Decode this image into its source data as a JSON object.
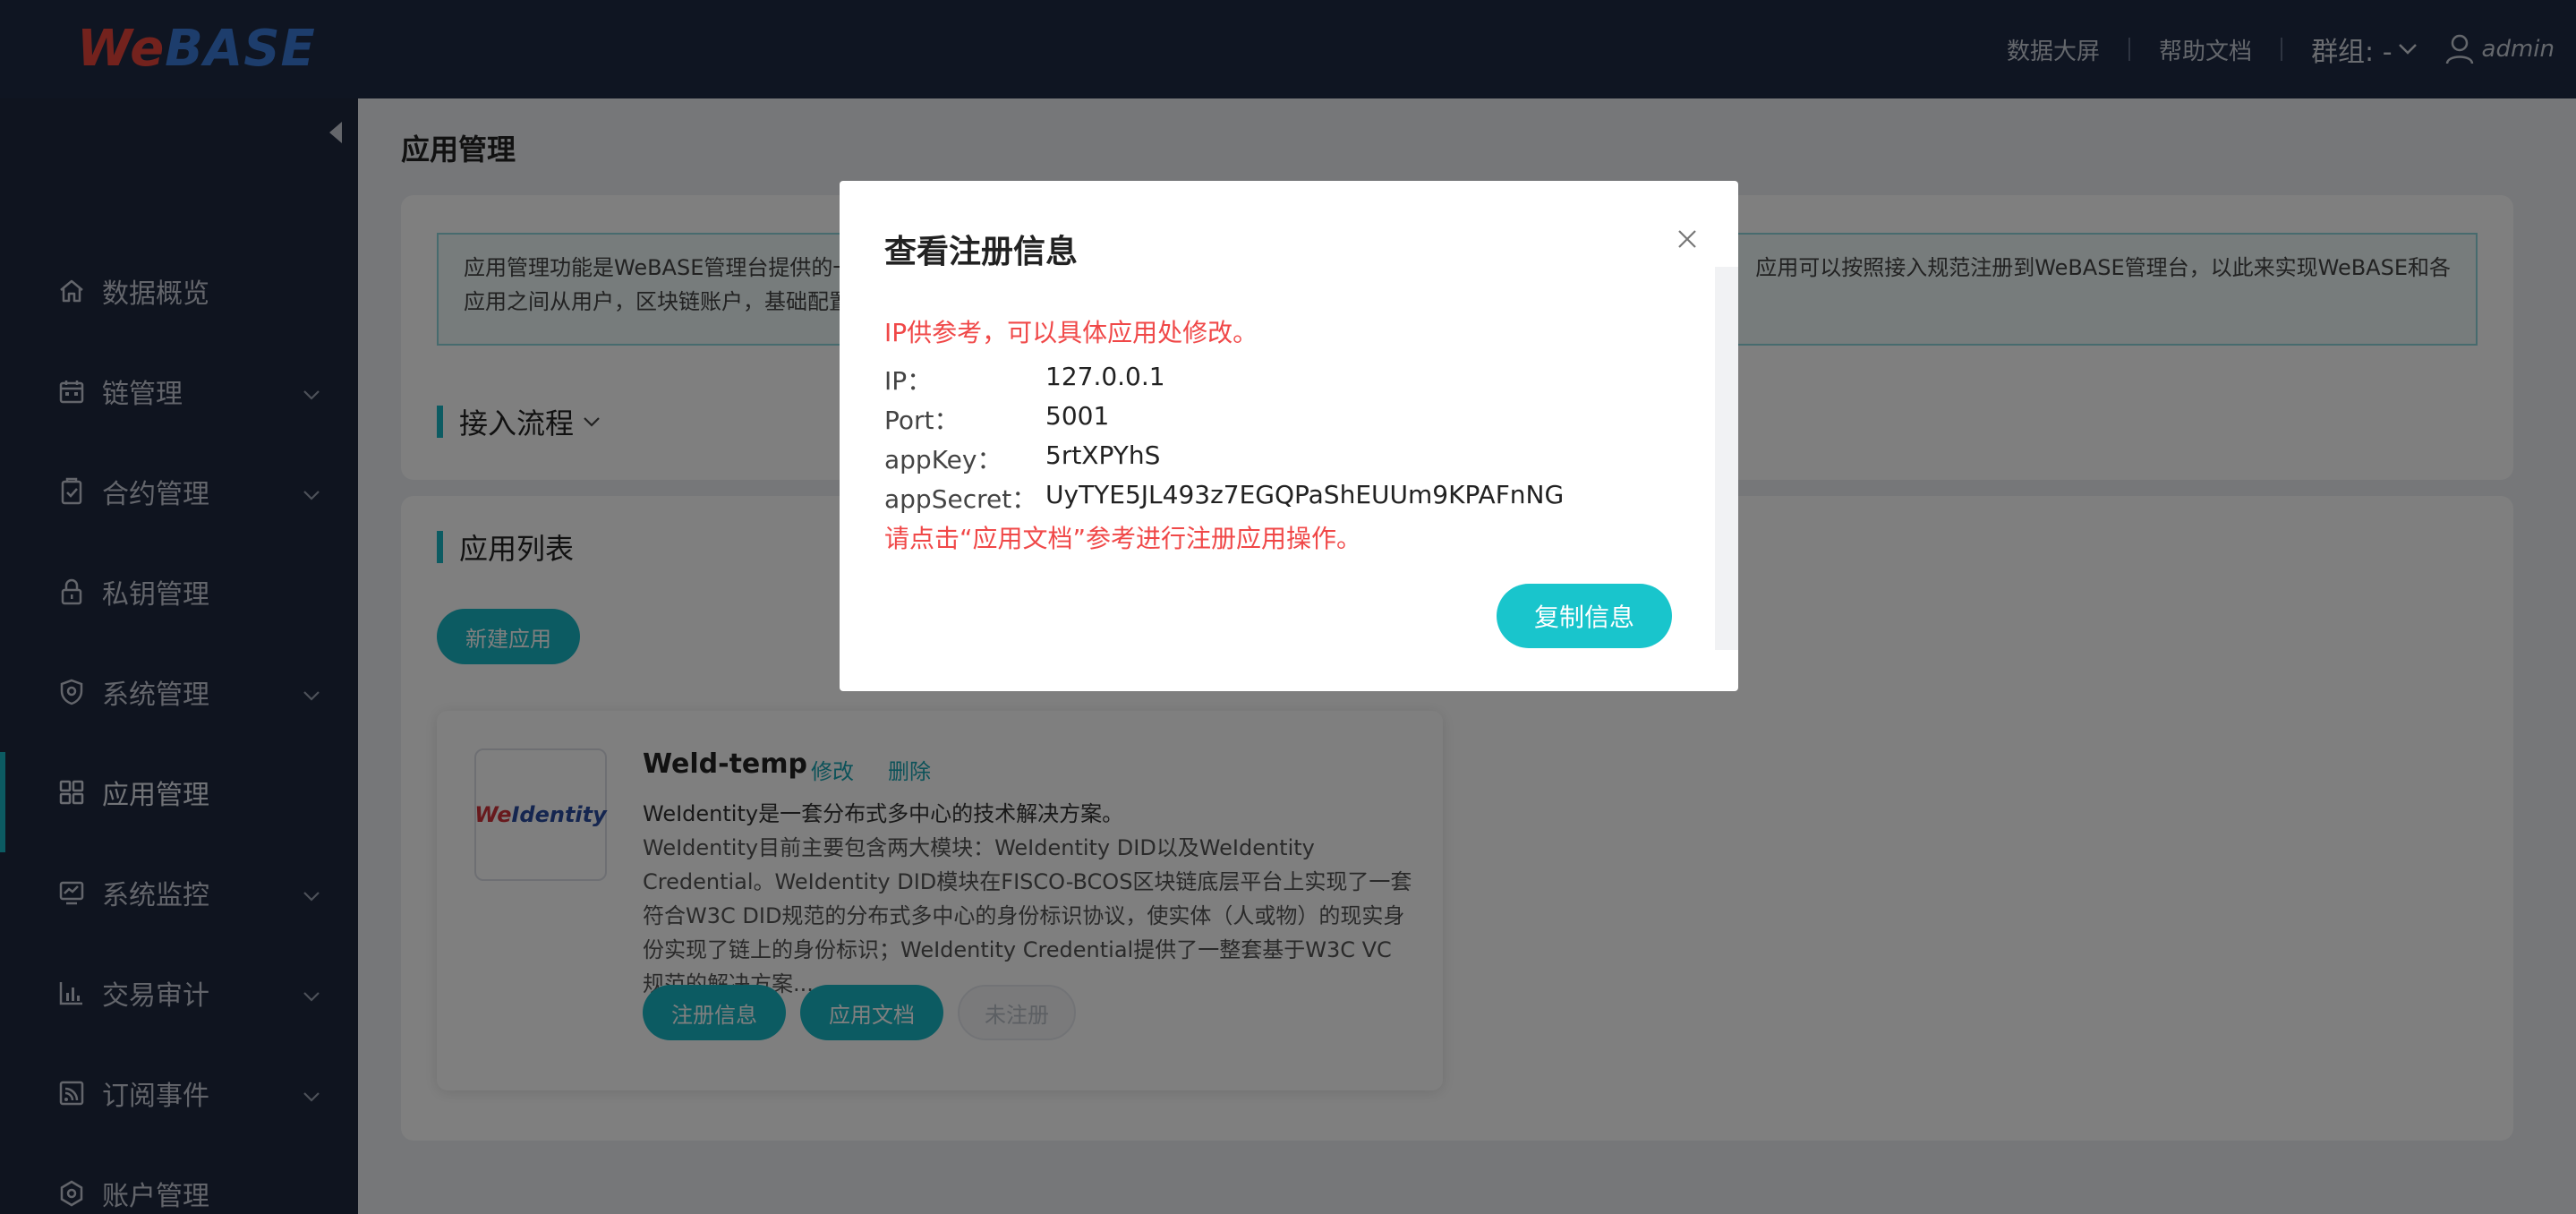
{
  "header": {
    "logo_we": "We",
    "logo_base": "BASE",
    "nav": [
      "数据大屏",
      "帮助文档"
    ],
    "group_label": "群组: -",
    "user": "admin"
  },
  "sidebar": {
    "items": [
      {
        "label": "数据概览",
        "icon": "home-icon",
        "has_children": false
      },
      {
        "label": "链管理",
        "icon": "calendar-icon",
        "has_children": true
      },
      {
        "label": "合约管理",
        "icon": "clipboard-icon",
        "has_children": true
      },
      {
        "label": "私钥管理",
        "icon": "lock-icon",
        "has_children": false
      },
      {
        "label": "系统管理",
        "icon": "shield-icon",
        "has_children": true
      },
      {
        "label": "应用管理",
        "icon": "grid-icon",
        "has_children": false,
        "active": true
      },
      {
        "label": "系统监控",
        "icon": "monitor-icon",
        "has_children": true
      },
      {
        "label": "交易审计",
        "icon": "bar-chart-icon",
        "has_children": true
      },
      {
        "label": "订阅事件",
        "icon": "rss-icon",
        "has_children": true
      },
      {
        "label": "账户管理",
        "icon": "hexagon-icon",
        "has_children": false
      }
    ]
  },
  "main": {
    "page_title": "应用管理",
    "notice_line1_left": "应用管理功能是WeBASE管理台提供的一",
    "notice_line1_right": "应用可以按照接入规范注册到WeBASE管理台，以此来实现WeBASE和各",
    "notice_line2": "应用之间从用户，区块链账户，基础配置",
    "process_title": "接入流程",
    "list_title": "应用列表",
    "new_app_button": "新建应用",
    "app": {
      "logo_we": "We",
      "logo_identity": "Identity",
      "name": "Weld-temp",
      "edit": "修改",
      "delete": "删除",
      "desc_first": "WeIdentity是一套分布式多中心的技术解决方案。",
      "desc_rest": "WeIdentity目前主要包含两大模块：WeIdentity DID以及WeIdentity Credential。WeIdentity DID模块在FISCO-BCOS区块链底层平台上实现了一套符合W3C DID规范的分布式多中心的身份标识协议，使实体（人或物）的现实身份实现了链上的身份标识；WeIdentity Credential提供了一整套基于W3C VC规范的解决方案...",
      "register_info_button": "注册信息",
      "app_doc_button": "应用文档",
      "status_button": "未注册"
    }
  },
  "dialog": {
    "title": "查看注册信息",
    "warning": "IP供参考，可以具体应用处修改。",
    "fields": [
      {
        "key": "IP：",
        "value": "127.0.0.1"
      },
      {
        "key": "Port：",
        "value": "5001"
      },
      {
        "key": "appKey：",
        "value": "5rtXPYhS"
      },
      {
        "key": "appSecret：",
        "value": "UyTYE5JL493z7EGQPaShEUUm9KPAFnNG"
      }
    ],
    "hint": "请点击“应用文档”参考进行注册应用操作。",
    "copy_button": "复制信息"
  },
  "colors": {
    "accent": "#19b7c4",
    "sidebar_bg": "#1e283e",
    "header_bg": "#1f2b45",
    "warning": "#f04848"
  }
}
